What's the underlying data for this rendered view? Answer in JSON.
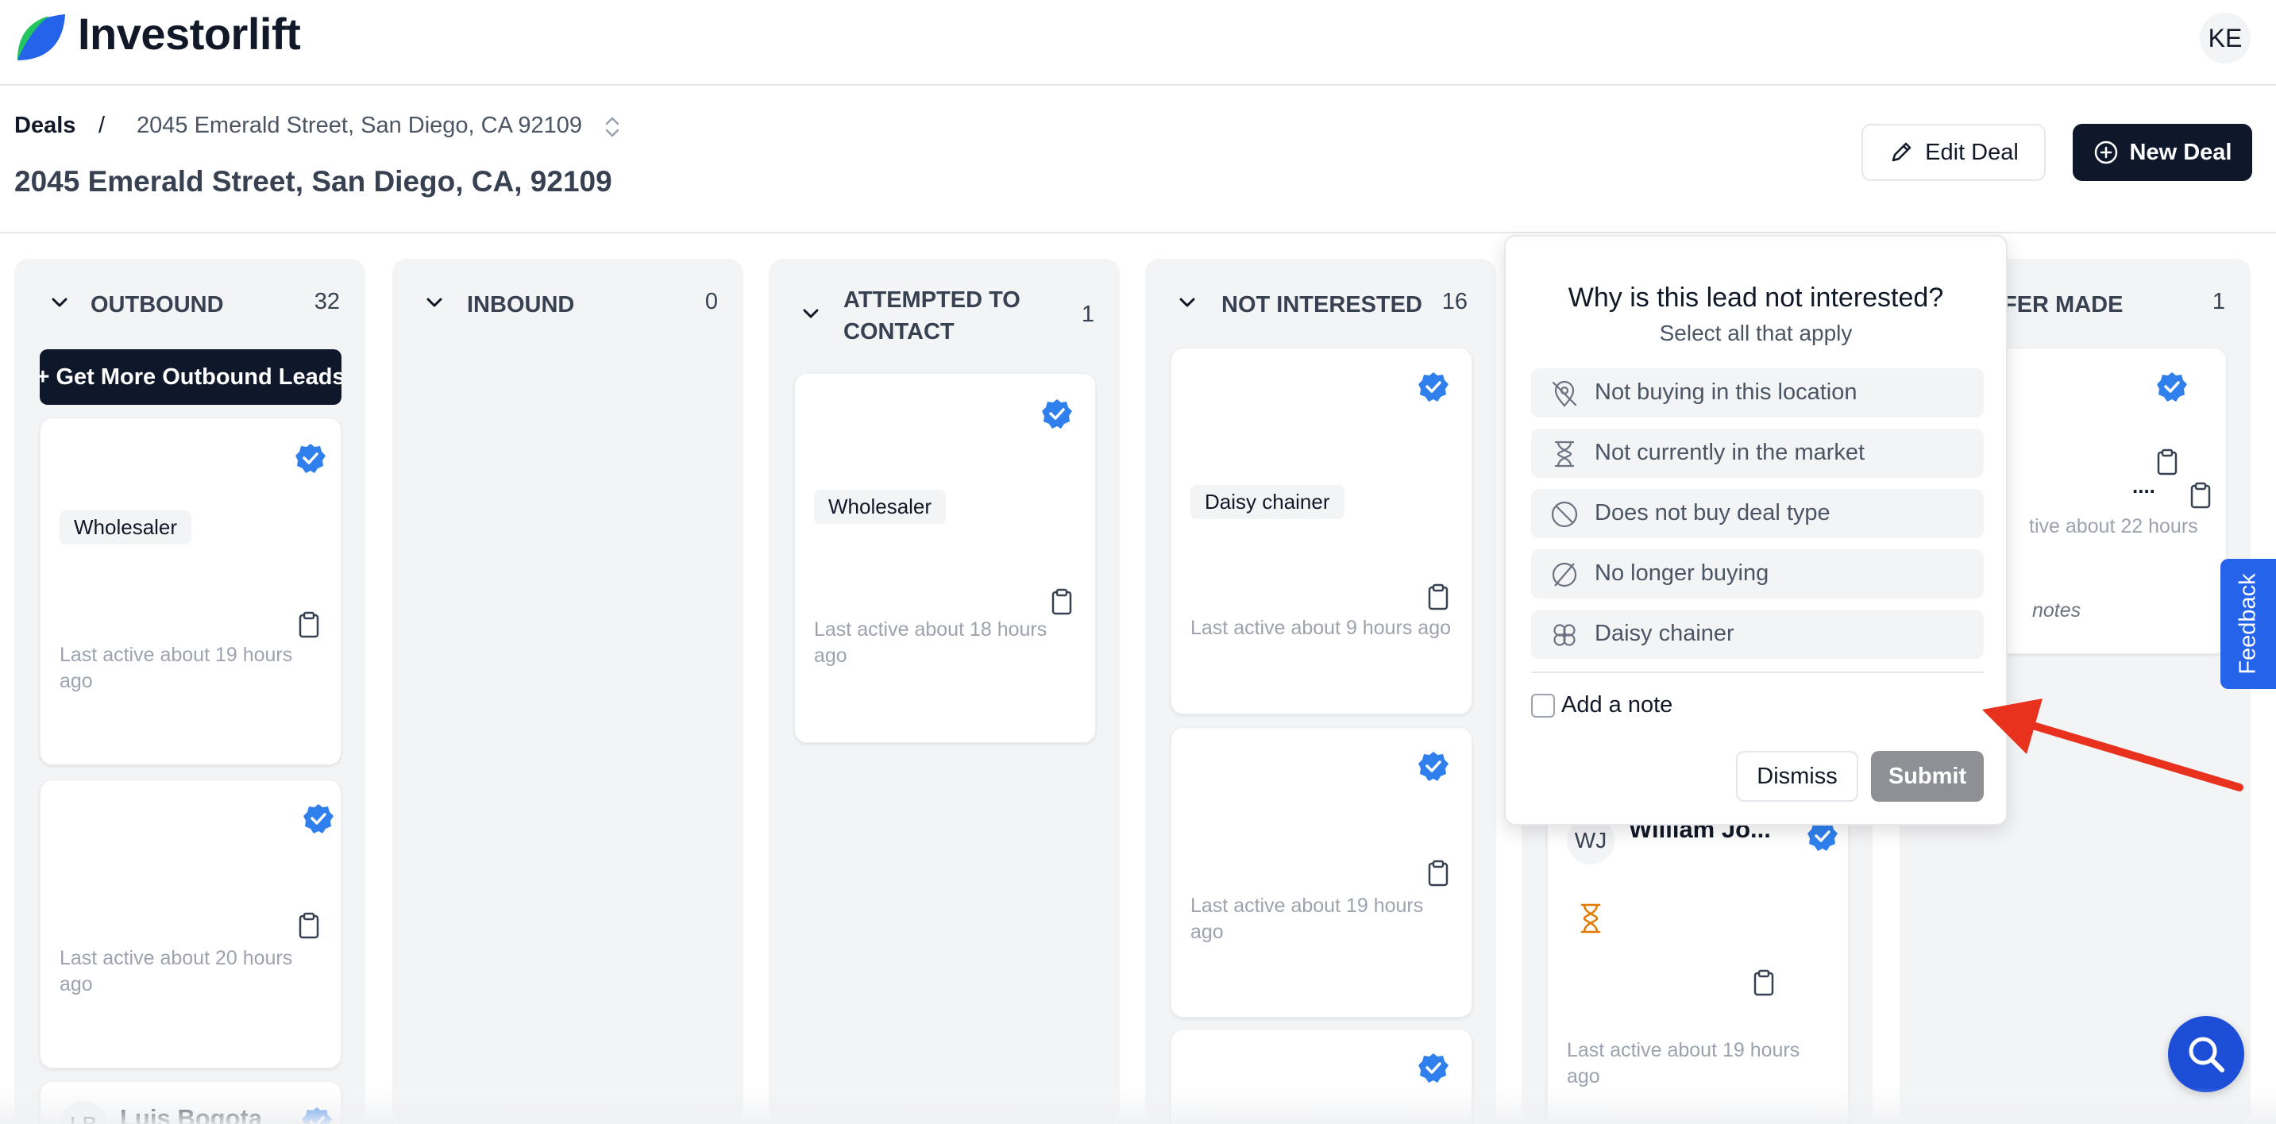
{
  "app": {
    "name": "Investorlift",
    "user_initials": "KE"
  },
  "breadcrumb": {
    "root": "Deals",
    "separator": "/",
    "current": "2045 Emerald Street, San Diego, CA 92109"
  },
  "deal": {
    "title": "2045 Emerald Street, San Diego, CA, 92109"
  },
  "actions": {
    "edit": "Edit Deal",
    "new": "New Deal"
  },
  "columns": [
    {
      "title": "OUTBOUND",
      "count": "32"
    },
    {
      "title": "INBOUND",
      "count": "0"
    },
    {
      "title_line1": "ATTEMPTED TO",
      "title_line2": "CONTACT",
      "count": "1"
    },
    {
      "title": "NOT INTERESTED",
      "count": "16"
    },
    {
      "title": "FER MADE",
      "count": "1"
    }
  ],
  "outbound": {
    "cta": "+ Get More Outbound Leads",
    "cards": [
      {
        "tag": "Wholesaler",
        "last_active_1": "Last active about 19 hours",
        "last_active_2": "ago"
      },
      {
        "last_active_1": "Last active about 20 hours",
        "last_active_2": "ago"
      },
      {
        "initials": "LB",
        "name": "Luis Bogota"
      }
    ]
  },
  "attempted": {
    "cards": [
      {
        "tag": "Wholesaler",
        "last_active_1": "Last active about 18 hours",
        "last_active_2": "ago"
      }
    ]
  },
  "not_interested": {
    "cards": [
      {
        "tag": "Daisy chainer",
        "last_active_1": "Last active about 9 hours ago"
      },
      {
        "last_active_1": "Last active about 19 hours",
        "last_active_2": "ago"
      }
    ]
  },
  "column5": {
    "card": {
      "initials": "WJ",
      "name": "William Jo...",
      "last_active_1": "Last active about 19 hours",
      "last_active_2": "ago"
    }
  },
  "offer_made": {
    "card": {
      "partial_name": "....",
      "last_active": "tive about 22 hours",
      "notes": "notes"
    }
  },
  "popover": {
    "title": "Why is this lead not interested?",
    "subtitle": "Select all that apply",
    "reasons": [
      {
        "label": "Not buying in this location",
        "icon": "location-off-icon"
      },
      {
        "label": "Not currently in the market",
        "icon": "hourglass-icon"
      },
      {
        "label": "Does not buy deal type",
        "icon": "ban-icon"
      },
      {
        "label": "No longer buying",
        "icon": "empty-set-icon"
      },
      {
        "label": "Daisy chainer",
        "icon": "flower-icon"
      }
    ],
    "note_label": "Add a note",
    "dismiss": "Dismiss",
    "submit": "Submit"
  },
  "feedback": "Feedback",
  "colors": {
    "primary_dark": "#0f172a",
    "brand_blue": "#2563eb",
    "verified_blue": "#2f80ed",
    "arrow_red": "#e8321e",
    "hourglass_orange": "#e07b00"
  }
}
